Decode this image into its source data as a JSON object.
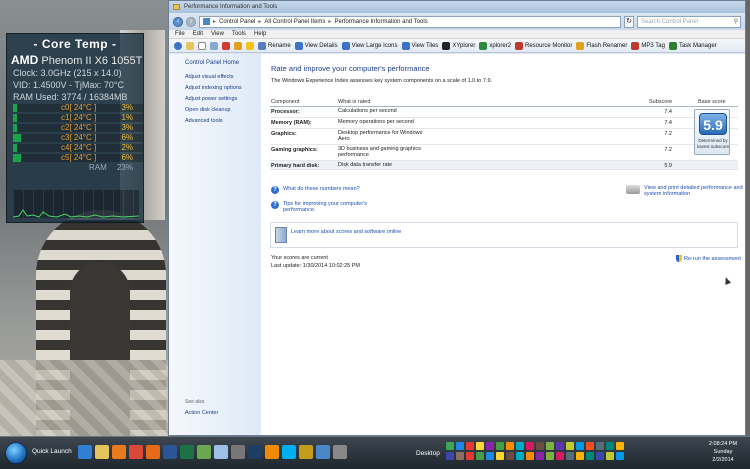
{
  "gadget": {
    "title": "- Core Temp -",
    "brand": "AMD",
    "cpu": "Phenom II X6 1055T",
    "clock": "Clock: 3.0GHz (215 x 14.0)",
    "vid_tjmax": "VID: 1.4500V - TjMax: 70°C",
    "ram_used": "RAM Used: 3774 / 16384MB",
    "cores": [
      {
        "label": "c0[ 24°C ]",
        "pct": "3%",
        "level": 0.03
      },
      {
        "label": "c1[ 24°C ]",
        "pct": "1%",
        "level": 0.01
      },
      {
        "label": "c2[ 24°C ]",
        "pct": "3%",
        "level": 0.03
      },
      {
        "label": "c3[ 24°C ]",
        "pct": "6%",
        "level": 0.06
      },
      {
        "label": "c4[ 24°C ]",
        "pct": "2%",
        "level": 0.02
      },
      {
        "label": "c5[ 24°C ]",
        "pct": "6%",
        "level": 0.06
      }
    ],
    "ram_label": "RAM",
    "ram_pct": "23%"
  },
  "window": {
    "title": "Performance Information and Tools",
    "address": [
      "Control Panel",
      "All Control Panel Items",
      "Performance Information and Tools"
    ],
    "search_placeholder": "Search Control Panel",
    "menu": [
      "File",
      "Edit",
      "View",
      "Tools",
      "Help"
    ],
    "toolbar": [
      {
        "label": "Rename",
        "icon": "rename-icon",
        "color": "#5a7bbd"
      },
      {
        "label": "View Details",
        "icon": "details-icon",
        "color": "#3b74c4"
      },
      {
        "label": "View Large Icons",
        "icon": "large-icons-icon",
        "color": "#3b74c4"
      },
      {
        "label": "View Tiles",
        "icon": "tiles-icon",
        "color": "#3b74c4"
      },
      {
        "label": "XYplorer",
        "icon": "xyplorer-icon",
        "color": "#222222"
      },
      {
        "label": "xplorer2",
        "icon": "xplorer2-icon",
        "color": "#2d8a3e"
      },
      {
        "label": "Resource Monitor",
        "icon": "resource-monitor-icon",
        "color": "#c0392b"
      },
      {
        "label": "Flash Renamer",
        "icon": "flash-renamer-icon",
        "color": "#e0a21c"
      },
      {
        "label": "MP3 Tag",
        "icon": "mp3tag-icon",
        "color": "#c0392b"
      },
      {
        "label": "Task Manager",
        "icon": "task-manager-icon",
        "color": "#2e7d32"
      }
    ]
  },
  "leftnav": {
    "home": "Control Panel Home",
    "links": [
      "Adjust visual effects",
      "Adjust indexing options",
      "Adjust power settings",
      "Open disk cleanup",
      "Advanced tools"
    ],
    "see_also": "See also",
    "action_center": "Action Center"
  },
  "content": {
    "title": "Rate and improve your computer's performance",
    "desc": "The Windows Experience Index assesses key system components on a scale of 1.0 to 7.9.",
    "headers": {
      "component": "Component",
      "rated": "What is rated",
      "subscore": "Subscore",
      "base": "Base score"
    },
    "rows": [
      {
        "component": "Processor:",
        "rated": "Calculations per second",
        "subscore": "7.4"
      },
      {
        "component": "Memory (RAM):",
        "rated": "Memory operations per second",
        "subscore": "7.4"
      },
      {
        "component": "Graphics:",
        "rated": "Desktop performance for Windows Aero",
        "subscore": "7.2"
      },
      {
        "component": "Gaming graphics:",
        "rated": "3D business and gaming graphics performance",
        "subscore": "7.2"
      },
      {
        "component": "Primary hard disk:",
        "rated": "Disk data transfer rate",
        "subscore": "5.9"
      }
    ],
    "base_score": "5.9",
    "determined": "Determined by lowest subscore",
    "help1": "What do these numbers mean?",
    "help2": "Tips for improving your computer's performance.",
    "print": "View and print detailed performance and system information",
    "learn": "Learn more about scores and software online",
    "current": "Your scores are current",
    "last_update": "Last update: 1/30/2014 10:02:25 PM",
    "rerun": "Re-run the assessment"
  },
  "taskbar": {
    "quick_launch": "Quick Launch",
    "desktop": "Desktop",
    "time": "2:08:24 PM",
    "day": "Sunday",
    "date": "2/2/2014"
  }
}
